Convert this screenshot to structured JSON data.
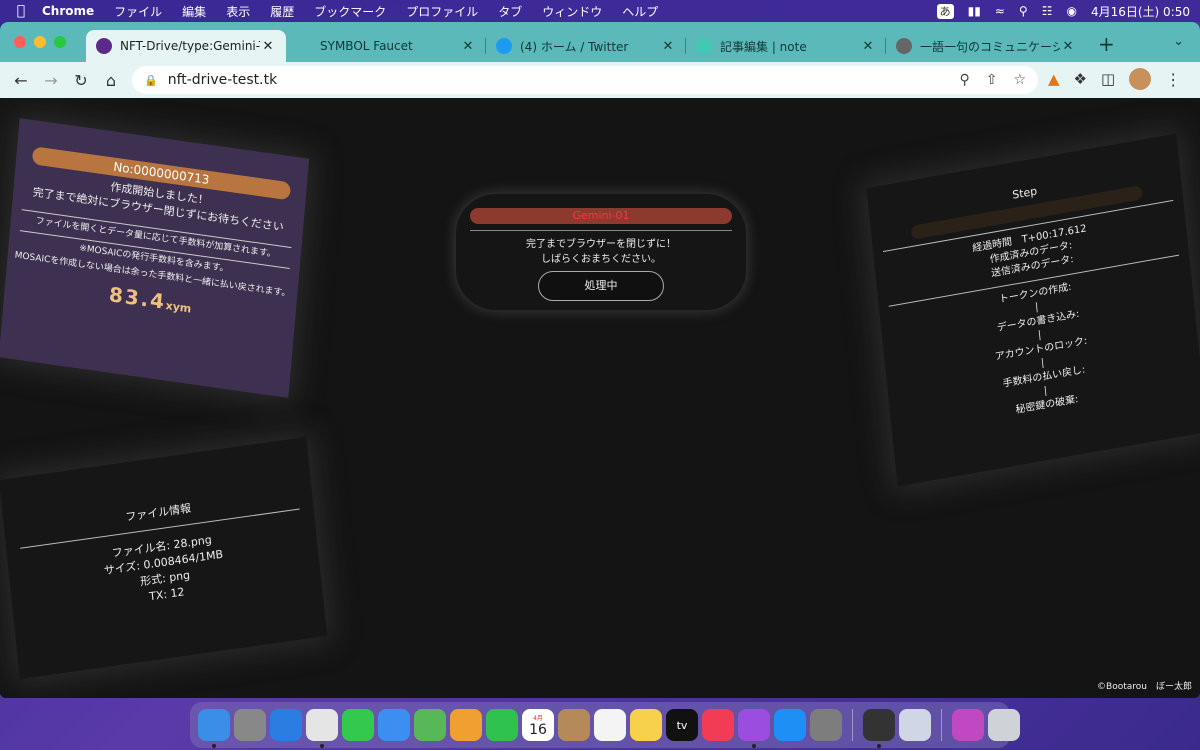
{
  "menubar": {
    "app_name": "Chrome",
    "items": [
      "ファイル",
      "編集",
      "表示",
      "履歴",
      "ブックマーク",
      "プロファイル",
      "タブ",
      "ウィンドウ",
      "ヘルプ"
    ],
    "ime": "あ",
    "datetime": "4月16日(土)  0:50"
  },
  "tabs": [
    {
      "label": "NFT-Drive/type:Gemini-TE",
      "favicon_color": "#5b2a8a",
      "icon": "shield-icon",
      "active": true
    },
    {
      "label": "SYMBOL Faucet",
      "favicon_color": "#5bb9b9",
      "icon": "symbol-icon",
      "active": false
    },
    {
      "label": "(4) ホーム / Twitter",
      "favicon_color": "#1d9bf0",
      "icon": "twitter-bird-icon",
      "active": false
    },
    {
      "label": "記事編集 | note",
      "favicon_color": "#41c9b4",
      "icon": "note-icon",
      "active": false
    },
    {
      "label": "一語一句のコミュニケーショ",
      "favicon_color": "#666666",
      "icon": "globe-icon",
      "active": false
    }
  ],
  "toolbar": {
    "url": "nft-drive-test.tk"
  },
  "mint_panel": {
    "number": "No:0000000713",
    "line1": "作成開始しました！",
    "line2": "完了まで絶対にブラウザー閉じずにお待ちください",
    "note1": "ファイルを開くとデータ量に応じて手数料が加算されます。",
    "note2": "※MOSAICの発行手数料を含みます。",
    "note3": "MOSAICを作成しない場合は余った手数料と一緒に払い戻されます。",
    "amount": "83.4",
    "unit": "xym"
  },
  "file_panel": {
    "title": "ファイル情報",
    "name": "ファイル名: 28.png",
    "size": "サイズ: 0.008464/1MB",
    "format": "形式: png",
    "tx": "TX: 12"
  },
  "center_panel": {
    "type": "Gemini-01",
    "msg1": "完了までブラウザーを閉じずに！",
    "msg2": "しばらくおまちください。",
    "button": "処理中"
  },
  "step_panel": {
    "title": "Step",
    "elapsed": "経過時間　T+00:17.612",
    "created": "作成済みのデータ:",
    "sent": "送信済みのデータ:",
    "steps": [
      "トークンの作成:",
      "データの書き込み:",
      "アカウントのロック:",
      "手数料の払い戻し:",
      "秘密鍵の破棄:"
    ],
    "connector": "|"
  },
  "copyright": "©Bootarou　ぼー太郎",
  "dock": {
    "calendar_month": "4月",
    "calendar_day": "16",
    "tv_label": "tv",
    "items": [
      {
        "name": "finder-icon",
        "color": "#3a8ee6",
        "run": true
      },
      {
        "name": "launchpad-icon",
        "color": "#888888",
        "run": false
      },
      {
        "name": "safari-icon",
        "color": "#2a7de1",
        "run": false
      },
      {
        "name": "chrome-icon",
        "color": "#e5e5e5",
        "run": true
      },
      {
        "name": "messages-icon",
        "color": "#33c94f",
        "run": false
      },
      {
        "name": "mail-icon",
        "color": "#3b8ff0",
        "run": false
      },
      {
        "name": "maps-icon",
        "color": "#58b857",
        "run": false
      },
      {
        "name": "photos-icon",
        "color": "#f0a030",
        "run": false
      },
      {
        "name": "facetime-icon",
        "color": "#2fc24f",
        "run": false
      },
      {
        "name": "calendar-icon",
        "color": "#ffffff",
        "run": false
      },
      {
        "name": "contacts-icon",
        "color": "#b58a5a",
        "run": false
      },
      {
        "name": "reminders-icon",
        "color": "#f4f4f4",
        "run": false
      },
      {
        "name": "notes-icon",
        "color": "#f7d14b",
        "run": false
      },
      {
        "name": "tv-icon",
        "color": "#111111",
        "run": false
      },
      {
        "name": "music-icon",
        "color": "#f23b55",
        "run": false
      },
      {
        "name": "podcasts-icon",
        "color": "#9b4de0",
        "run": true
      },
      {
        "name": "app-store-icon",
        "color": "#1e8ff5",
        "run": false
      },
      {
        "name": "system-preferences-icon",
        "color": "#7d7d7d",
        "run": false
      }
    ],
    "extra": [
      {
        "name": "piano-icon",
        "color": "#333333",
        "run": true
      },
      {
        "name": "preview-icon",
        "color": "#d0d6e6",
        "run": false
      }
    ],
    "tail": [
      {
        "name": "desktop-folder-icon",
        "color": "#c048c0",
        "run": false
      },
      {
        "name": "trash-icon",
        "color": "#cfd3d8",
        "run": false
      }
    ]
  }
}
